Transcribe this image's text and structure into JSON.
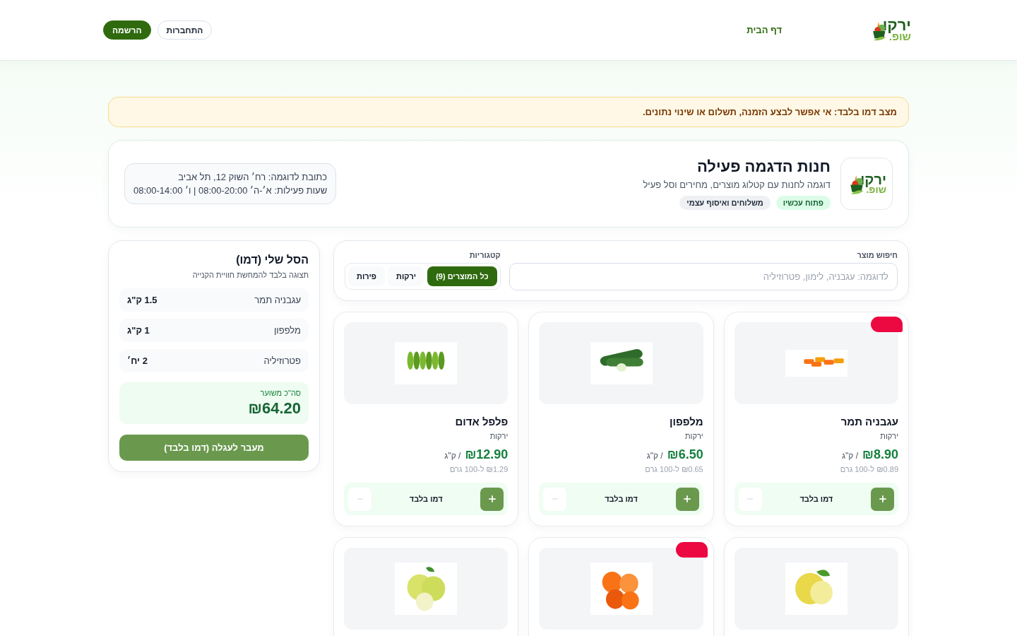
{
  "header": {
    "logo": {
      "top": "ירקו",
      "bottom": "שופ."
    },
    "nav": [
      {
        "label": "דף הבית",
        "selected": true
      }
    ],
    "buttons": [
      {
        "label": "התחברות",
        "kind": "outline"
      },
      {
        "label": "הרשמה",
        "kind": "primary"
      }
    ]
  },
  "notice": "מצב דמו בלבד: אי אפשר לבצע הזמנה, תשלום או שינוי נתונים.",
  "store": {
    "logo": {
      "top": "ירקו",
      "bottom": "שופ."
    },
    "name": "חנות הדגמה פעילה",
    "description": "דוגמה לחנות עם קטלוג מוצרים, מחירים וסל פעיל",
    "tags": [
      {
        "label": "פתוח עכשיו",
        "kind": "status"
      },
      {
        "label": "משלוחים ואיסוף עצמי",
        "kind": "info"
      }
    ],
    "address": "כתובת לדוגמה: רח׳ השוק 12, תל אביב",
    "hours": "שעות פעילות: א׳-ה׳ 08:00-20:00 | ו׳ 08:00-14:00"
  },
  "search": {
    "label": "חיפוש מוצר",
    "placeholder": "לדוגמה: עגבניה, לימון, פטרוזיליה"
  },
  "categories": {
    "label": "קטגוריות",
    "items": [
      {
        "label": "כל המוצרים (9)",
        "selected": true
      },
      {
        "label": "ירקות",
        "selected": false
      },
      {
        "label": "פירות",
        "selected": false
      }
    ]
  },
  "products": [
    {
      "name": "עגבניה תמר",
      "category": "ירקות",
      "price": "₪8.90",
      "unit": "/ ק\"ג",
      "per100": "₪0.89 ל-100 גרם",
      "control": "דמו בלבד",
      "flag": true
    },
    {
      "name": "מלפפון",
      "category": "ירקות",
      "price": "₪6.50",
      "unit": "/ ק\"ג",
      "per100": "₪0.65 ל-100 גרם",
      "control": "דמו בלבד",
      "flag": false
    },
    {
      "name": "פלפל אדום",
      "category": "ירקות",
      "price": "₪12.90",
      "unit": "/ ק\"ג",
      "per100": "₪1.29 ל-100 גרם",
      "control": "דמו בלבד",
      "flag": false
    },
    {
      "flag": false
    },
    {
      "flag": true
    },
    {
      "flag": false
    }
  ],
  "cart": {
    "title": "הסל שלי (דמו)",
    "subtitle": "תצוגה בלבד להמחשת חוויית הקנייה",
    "items": [
      {
        "name": "עגבניה תמר",
        "qty": "1.5 ק\"ג"
      },
      {
        "name": "מלפפון",
        "qty": "1 ק\"ג"
      },
      {
        "name": "פטרוזיליה",
        "qty": "2 יח׳"
      }
    ],
    "total_label": "סה\"כ משוער",
    "total": "₪64.20",
    "checkout": "מעבר לעגלה (דמו בלבד)"
  }
}
